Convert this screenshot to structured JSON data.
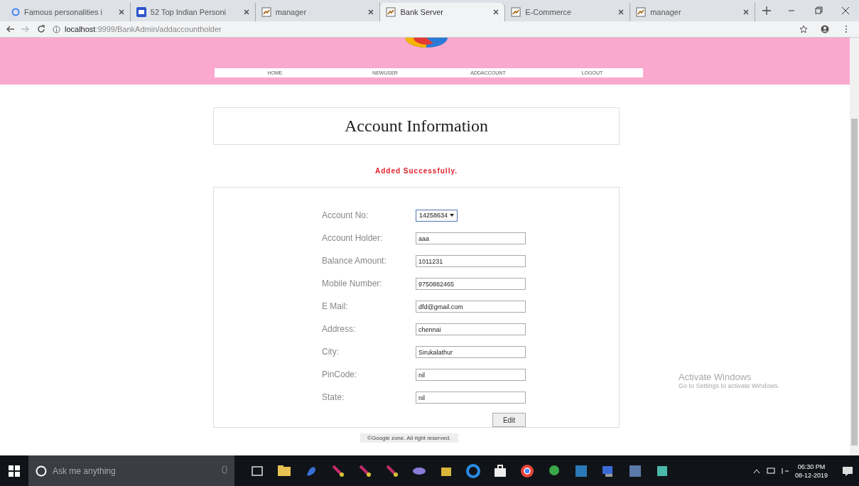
{
  "browser": {
    "tabs": [
      {
        "title": "Famous personalities i",
        "selected": false,
        "kind": "search"
      },
      {
        "title": "52 Top Indian Personi",
        "selected": false,
        "kind": "site"
      },
      {
        "title": "manager",
        "selected": false,
        "kind": "page"
      },
      {
        "title": "Bank Server",
        "selected": true,
        "kind": "page"
      },
      {
        "title": "E-Commerce",
        "selected": false,
        "kind": "page"
      },
      {
        "title": "manager",
        "selected": false,
        "kind": "page"
      }
    ],
    "url_host": "localhost",
    "url_path": ":9999/BankAdmin/addaccountholder"
  },
  "nav": [
    "HOME",
    "NEWUSER",
    "ADDACCOUNT",
    "LOGOUT"
  ],
  "heading": "Account Information",
  "message": "Added Successfully.",
  "form": {
    "fields": [
      {
        "label": "Account No:",
        "kind": "select",
        "value": "14258634"
      },
      {
        "label": "Account Holder:",
        "kind": "text",
        "value": "aaa"
      },
      {
        "label": "Balance Amount:",
        "kind": "text",
        "value": "1011231"
      },
      {
        "label": "Mobile Number:",
        "kind": "text",
        "value": "9750882465"
      },
      {
        "label": "E Mail:",
        "kind": "text",
        "value": "dfd@gmail.com"
      },
      {
        "label": "Address:",
        "kind": "text",
        "value": "chennai"
      },
      {
        "label": "City:",
        "kind": "text",
        "value": "Sirukalathur"
      },
      {
        "label": "PinCode:",
        "kind": "text",
        "value": "nil"
      },
      {
        "label": "State:",
        "kind": "text",
        "value": "nil"
      }
    ],
    "button": "Edit"
  },
  "footer": "©Google zone. All right reserved.",
  "activation": {
    "title": "Activate Windows",
    "subtitle": "Go to Settings to activate Windows."
  },
  "taskbar": {
    "search_placeholder": "Ask me anything",
    "time": "06:30 PM",
    "date": "08-12-2019"
  }
}
